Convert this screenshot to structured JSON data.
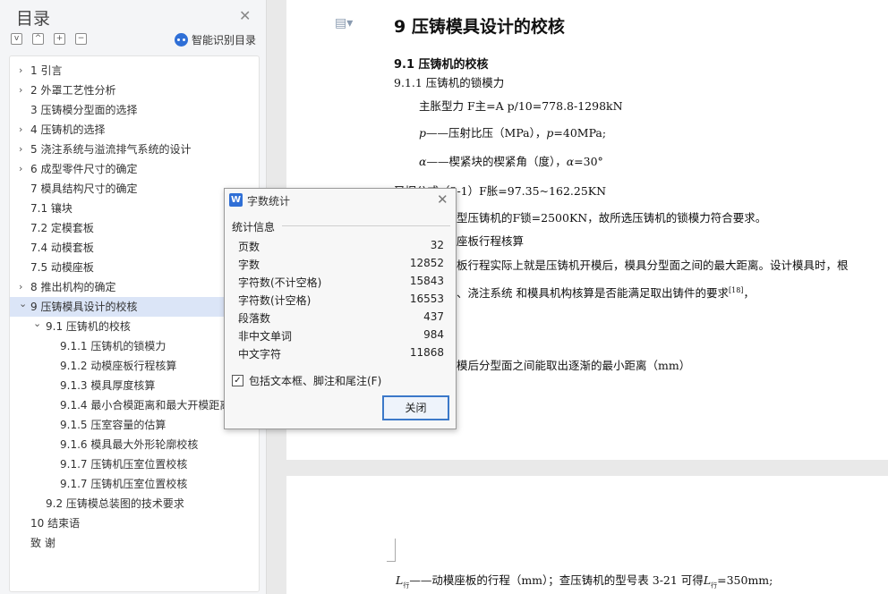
{
  "sidebar": {
    "title": "目录",
    "smart_label": "智能识别目录",
    "tools": [
      "v",
      "^",
      "+",
      "−"
    ],
    "items": [
      {
        "label": "1  引言",
        "expand": ">"
      },
      {
        "label": "2  外罩工艺性分析",
        "expand": ">"
      },
      {
        "label": "3  压铸模分型面的选择",
        "expand": ""
      },
      {
        "label": "4   压铸机的选择",
        "expand": ">"
      },
      {
        "label": "5   浇注系统与溢流排气系统的设计",
        "expand": ">"
      },
      {
        "label": "6  成型零件尺寸的确定",
        "expand": ">"
      },
      {
        "label": "7   模具结构尺寸的确定",
        "expand": ""
      },
      {
        "label": "7.1    镶块",
        "expand": ""
      },
      {
        "label": "7.2  定模套板",
        "expand": ""
      },
      {
        "label": "7.4  动模套板",
        "expand": ""
      },
      {
        "label": "7.5  动模座板",
        "expand": ""
      },
      {
        "label": "8  推出机构的确定",
        "expand": ">"
      },
      {
        "label": "9  压铸模具设计的校核",
        "expand": "v"
      },
      {
        "label": "9.1  压铸机的校核",
        "expand": "v"
      },
      {
        "label": "9.1.1  压铸机的锁模力",
        "expand": ""
      },
      {
        "label": "9.1.2  动模座板行程核算",
        "expand": ""
      },
      {
        "label": "9.1.3  模具厚度核算",
        "expand": ""
      },
      {
        "label": "9.1.4  最小合模距离和最大开模距离",
        "expand": ""
      },
      {
        "label": "9.1.5  压室容量的估算",
        "expand": ""
      },
      {
        "label": "9.1.6  模具最大外形轮廓校核",
        "expand": ""
      },
      {
        "label": "9.1.7  压铸机压室位置校核",
        "expand": ""
      },
      {
        "label": "9.1.7  压铸机压室位置校核",
        "expand": ""
      },
      {
        "label": "9.2  压铸模总装图的技术要求",
        "expand": ""
      },
      {
        "label": "10    结束语",
        "expand": ""
      },
      {
        "label": "致    谢",
        "expand": ""
      }
    ]
  },
  "document": {
    "heading": "9  压铸模具设计的校核",
    "sub1": "9.1  压铸机的校核",
    "sub2": "9.1.1  压铸机的锁模力",
    "line1": "主胀型力 F主=A p/10=778.8-1298kN",
    "line2a": "p",
    "line2b": "——压射比压（MPa），",
    "line2c": "p",
    "line2d": "=40MPa;",
    "line3a": "α",
    "line3b": "——楔紧块的楔紧角（度），",
    "line3c": "α",
    "line3d": "=30°",
    "line4": "又据公式（3-1）F胀=97.35~162.25KN",
    "line5": "型压铸机的F锁=2500KN，故所选压铸机的锁模力符合要求。",
    "line6": "座板行程核算",
    "line7": "板行程实际上就是压铸机开模后，模具分型面之间的最大距离。设计模具时，根",
    "line8": "、浇注系统 和模具机构核算是否能满足取出铸件的要求",
    "line8ref": "[18]",
    "line8end": "，",
    "line9": "模后分型面之间能取出逐渐的最小距离（mm）",
    "p2a": "L",
    "p2b": "行",
    "p2c": "——动模座板的行程（mm）；查压铸机的型号表 3-21 可得",
    "p2d": "L",
    "p2e": "行",
    "p2f": "=350mm;"
  },
  "dialog": {
    "logo": "W",
    "title": "字数统计",
    "section": "统计信息",
    "stats": [
      {
        "key": "页数",
        "value": "32"
      },
      {
        "key": "字数",
        "value": "12852"
      },
      {
        "key": "字符数(不计空格)",
        "value": "15843"
      },
      {
        "key": "字符数(计空格)",
        "value": "16553"
      },
      {
        "key": "段落数",
        "value": "437"
      },
      {
        "key": "非中文单词",
        "value": "984"
      },
      {
        "key": "中文字符",
        "value": "11868"
      }
    ],
    "checkbox_label": "包括文本框、脚注和尾注(F)",
    "checkbox_checked": true,
    "close_label": "关闭"
  },
  "colors": {
    "accent": "#2f6fd6",
    "active_row": "#dbe5f7"
  }
}
